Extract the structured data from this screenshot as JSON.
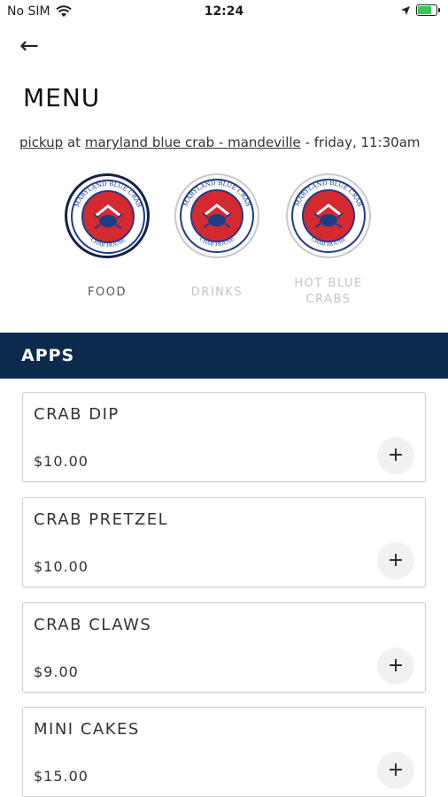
{
  "status_bar": {
    "carrier": "No SIM",
    "time": "12:24"
  },
  "header": {
    "title": "MENU"
  },
  "order_info": {
    "mode": "pickup",
    "at": "at",
    "location": "maryland blue crab - mandeville",
    "when": "- friday, 11:30am"
  },
  "categories": [
    {
      "label": "FOOD",
      "active": true
    },
    {
      "label": "DRINKS",
      "active": false
    },
    {
      "label": "HOT BLUE CRABS",
      "active": false
    }
  ],
  "logo_text": {
    "top": "MARYLAND BLUE CRAB",
    "bottom": "CRAB HOUSE"
  },
  "section": {
    "title": "APPS"
  },
  "items": [
    {
      "name": "CRAB DIP",
      "price": "$10.00"
    },
    {
      "name": "CRAB PRETZEL",
      "price": "$10.00"
    },
    {
      "name": "CRAB CLAWS",
      "price": "$9.00"
    },
    {
      "name": "MINI CAKES",
      "price": "$15.00"
    }
  ],
  "colors": {
    "navy": "#0c2a4e",
    "logo_red": "#d42a2f",
    "logo_blue": "#1f3c86"
  }
}
